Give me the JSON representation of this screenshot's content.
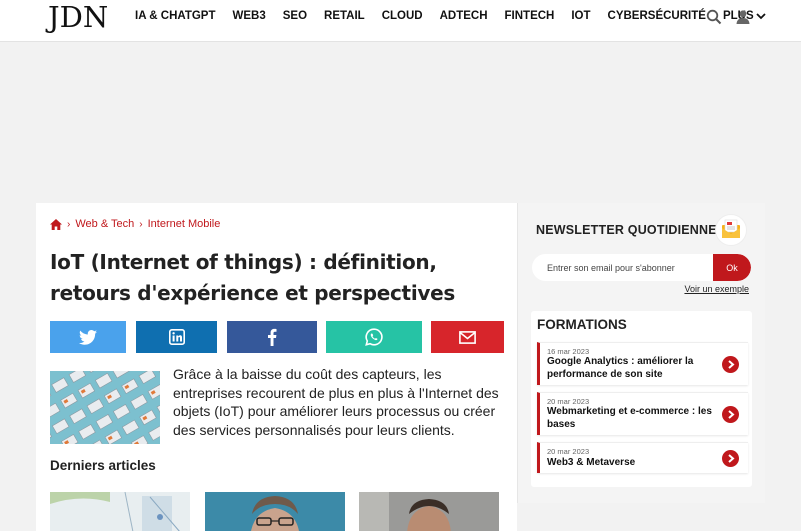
{
  "header": {
    "logo": "JDN",
    "nav": [
      "IA & CHATGPT",
      "WEB3",
      "SEO",
      "RETAIL",
      "CLOUD",
      "ADTECH",
      "FINTECH",
      "IOT",
      "CYBERSÉCURITÉ"
    ],
    "more_label": "PLUS"
  },
  "breadcrumb": {
    "items": [
      "Web & Tech",
      "Internet Mobile"
    ]
  },
  "article": {
    "title": "IoT (Internet of things) : définition, retours d'expérience et perspectives",
    "lead": "Grâce à la baisse du coût des capteurs, les entreprises recourent de plus en plus à l'Internet des objets (IoT) pour améliorer leurs processus ou créer des services personnalisés pour leurs clients.",
    "latest_heading": "Derniers articles"
  },
  "share": {
    "buttons": [
      {
        "name": "twitter",
        "color": "#4aa2ec"
      },
      {
        "name": "linkedin",
        "color": "#0f6fb0"
      },
      {
        "name": "facebook",
        "color": "#35589a"
      },
      {
        "name": "whatsapp",
        "color": "#26c3a5"
      },
      {
        "name": "email",
        "color": "#d7252b"
      }
    ]
  },
  "newsletter": {
    "title": "NEWSLETTER QUOTIDIENNE",
    "placeholder": "Entrer son email pour s'abonner",
    "button": "Ok",
    "example_link": "Voir un exemple"
  },
  "formations": {
    "title": "FORMATIONS",
    "items": [
      {
        "date": "16 mar 2023",
        "name": "Google Analytics : améliorer la performance de son site"
      },
      {
        "date": "20 mar 2023",
        "name": "Webmarketing et e-commerce : les bases"
      },
      {
        "date": "20 mar 2023",
        "name": "Web3 & Metaverse"
      }
    ]
  },
  "colors": {
    "accent": "#c0181c",
    "background": "#f2f2f2"
  }
}
